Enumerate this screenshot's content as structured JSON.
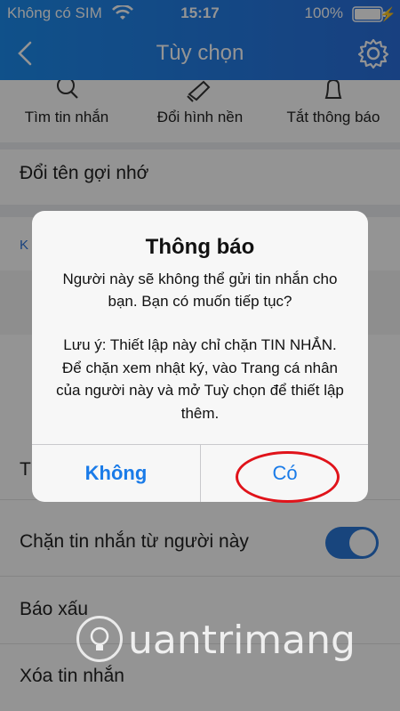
{
  "status_bar": {
    "carrier": "Không có SIM",
    "time": "15:17",
    "battery": "100%"
  },
  "nav": {
    "title": "Tùy chọn"
  },
  "quick_actions": [
    {
      "label": "Tìm tin nhắn",
      "icon": "search-icon"
    },
    {
      "label": "Đổi hình nền",
      "icon": "brush-icon"
    },
    {
      "label": "Tắt thông báo",
      "icon": "bell-icon"
    }
  ],
  "options": {
    "rename": "Đổi tên gợi nhớ",
    "section_partial": "K",
    "row_partial": "T",
    "block_messages": "Chặn tin nhắn từ người này",
    "block_messages_on": true,
    "report": "Báo xấu",
    "delete": "Xóa tin nhắn"
  },
  "alert": {
    "title": "Thông báo",
    "message": "Người này sẽ không thể gửi tin nhắn cho bạn. Bạn có muốn tiếp tục?",
    "note": "Lưu ý: Thiết lập này chỉ chặn TIN NHẮN. Để chặn xem nhật ký, vào Trang cá nhân của người này và mở Tuỳ chọn để thiết lập thêm.",
    "cancel_label": "Không",
    "confirm_label": "Có"
  },
  "watermark": {
    "text": "uantrimang"
  },
  "colors": {
    "accent": "#1a7be8",
    "header": "#2a6fdc",
    "toggle": "#2a77d8",
    "highlight": "#e0131a"
  }
}
